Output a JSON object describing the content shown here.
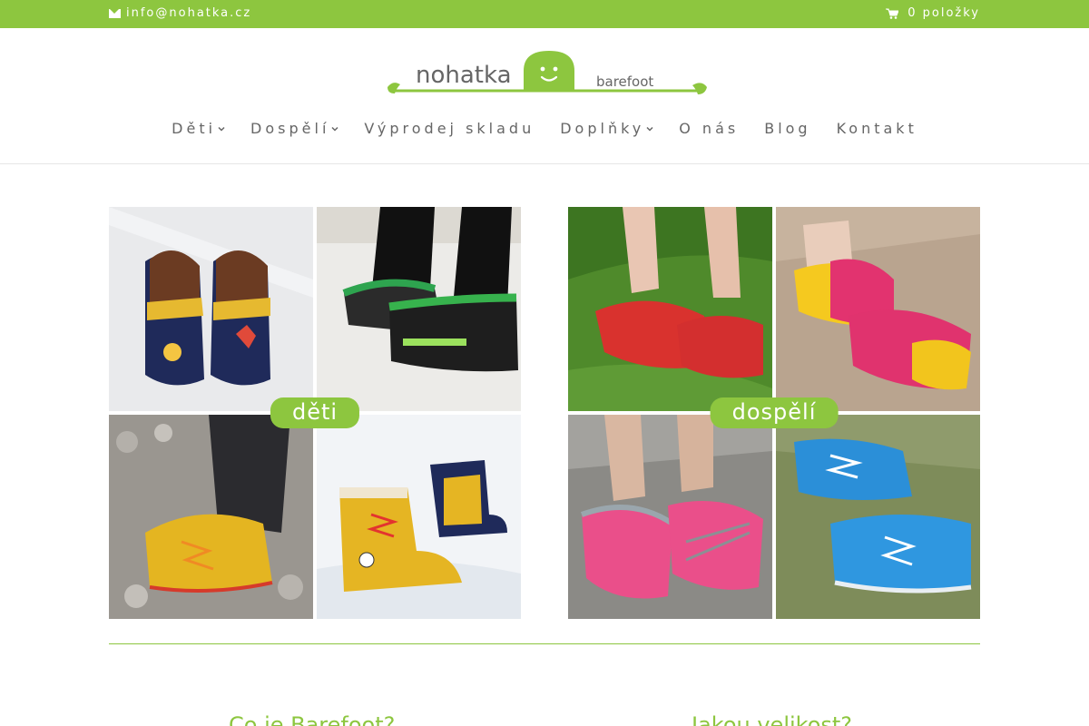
{
  "topbar": {
    "email": "info@nohatka.cz",
    "cart_label": "0 položky",
    "bg_color": "#8dc63f"
  },
  "logo": {
    "word": "nohatka",
    "sub": "barefoot"
  },
  "nav": {
    "items": [
      {
        "label": "Děti",
        "has_dropdown": true
      },
      {
        "label": "Dospělí",
        "has_dropdown": true
      },
      {
        "label": "Výprodej skladu",
        "has_dropdown": false
      },
      {
        "label": "Doplňky",
        "has_dropdown": true
      },
      {
        "label": "O nás",
        "has_dropdown": false
      },
      {
        "label": "Blog",
        "has_dropdown": false
      },
      {
        "label": "Kontakt",
        "has_dropdown": false
      }
    ]
  },
  "tiles": {
    "kids_label": "děti",
    "adults_label": "dospělí"
  },
  "sections": {
    "left_heading": "Co je Barefoot?",
    "right_heading": "Jakou velikost?"
  },
  "colors": {
    "accent": "#8dc63f"
  }
}
